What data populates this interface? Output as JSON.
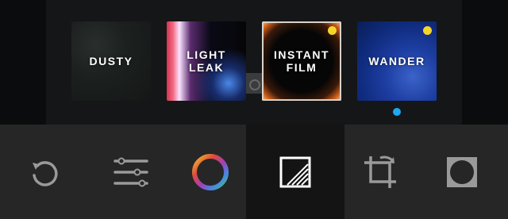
{
  "presets": [
    {
      "name": "DUSTY",
      "dot": false,
      "bg": "dusty"
    },
    {
      "name": "LIGHT\nLEAK",
      "dot": false,
      "bg": "lightleak"
    },
    {
      "name": "INSTANT\nFILM",
      "dot": true,
      "bg": "instant"
    },
    {
      "name": "WANDER",
      "dot": true,
      "bg": "wander"
    }
  ],
  "selected_preset": "WANDER",
  "colors": {
    "premium_dot": "#f4d52b",
    "selected_dot": "#1ea7f2",
    "toolbar_bg": "#262626",
    "active_tool_bg": "#141414",
    "icon": "#9a9a9a",
    "icon_active": "#ffffff"
  },
  "toolbar": {
    "tools": [
      {
        "icon": "reset-icon",
        "active": false
      },
      {
        "icon": "adjustments-sliders-icon",
        "active": false
      },
      {
        "icon": "color-wheel-icon",
        "active": false
      },
      {
        "icon": "filter-effects-icon",
        "active": true
      },
      {
        "icon": "crop-rotate-icon",
        "active": false
      },
      {
        "icon": "vignette-icon",
        "active": false
      }
    ]
  }
}
